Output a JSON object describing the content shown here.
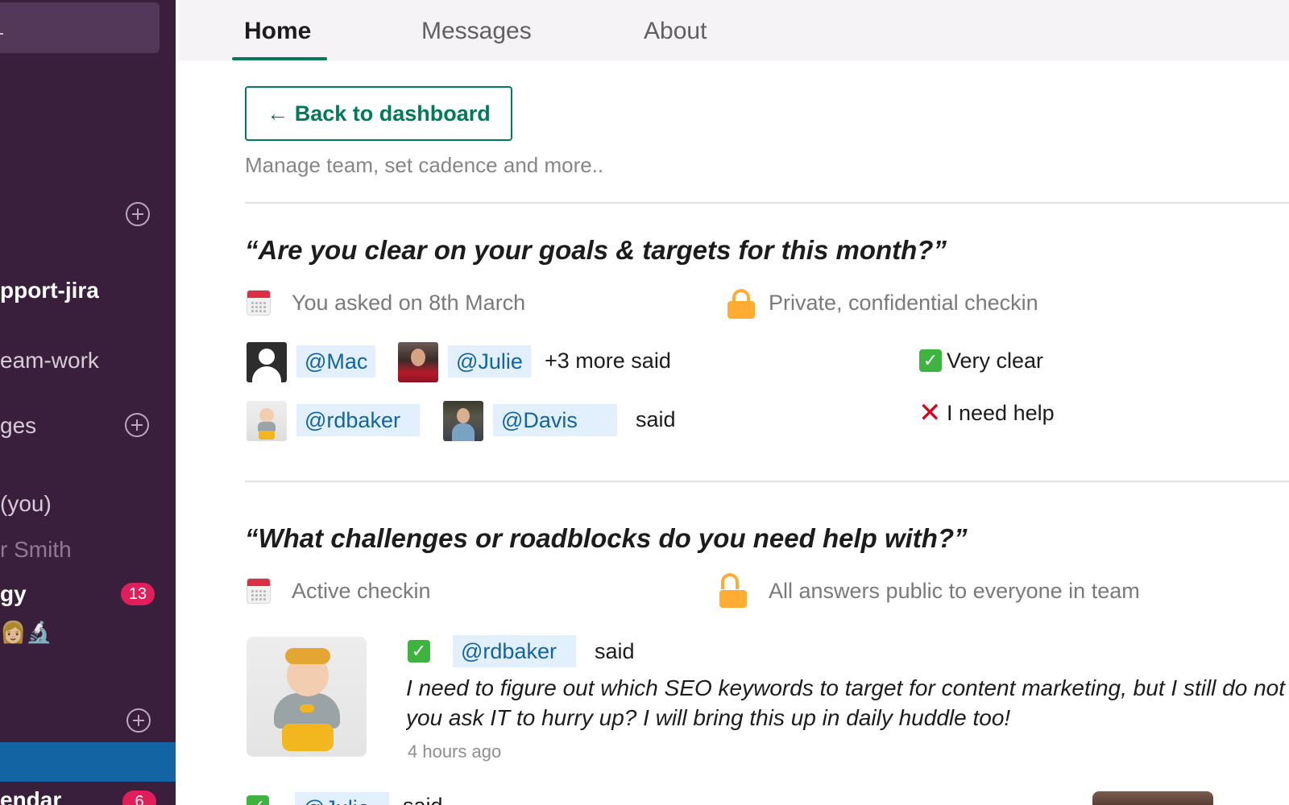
{
  "sidebar": {
    "channel_bold": "pport-jira",
    "channel_teamwork": "eam-work",
    "section_messages": "ges",
    "dm_you": "(you)",
    "dm_smith": "r Smith",
    "dm_gy": "gy",
    "dm_gy_badge": "13",
    "emoji_row": "👩🏼🔬",
    "calendar_item": "endar",
    "calendar_badge": "6"
  },
  "tabs": [
    {
      "label": "Home",
      "active": true
    },
    {
      "label": "Messages",
      "active": false
    },
    {
      "label": "About",
      "active": false
    }
  ],
  "main": {
    "back_button": "← Back to dashboard",
    "subtitle": "Manage team, set cadence and more..",
    "checkins": [
      {
        "question": "“Are you clear on your goals & targets for this month?”",
        "date_text": "You asked on 8th March",
        "privacy_text": "Private, confidential checkin",
        "rows": [
          {
            "mentions": [
              "@Mac",
              "@Julie"
            ],
            "suffix": "+3 more said",
            "answer_icon": "check",
            "answer": "Very clear"
          },
          {
            "mentions": [
              "@rdbaker",
              "@Davis"
            ],
            "suffix": "said",
            "answer_icon": "cross",
            "answer": "I need help"
          }
        ]
      },
      {
        "question": "“What challenges or roadblocks do you need help with?”",
        "date_text": "Active checkin",
        "privacy_text": "All answers public to everyone in team",
        "response": {
          "mention": "@rdbaker",
          "suffix": "said",
          "text_line1": "I need to figure out which SEO keywords to target for content marketing, but I still do not ha",
          "text_line2": "you ask IT to hurry up? I will bring this up in daily huddle too!",
          "time": "4 hours ago"
        },
        "next_response": {
          "mention": "@Julie",
          "suffix": "said"
        }
      }
    ]
  },
  "colors": {
    "sidebar_bg": "#3a1f3d",
    "accent_green": "#007a5a",
    "mention_bg": "#e1f0fc",
    "mention_text": "#1264a3",
    "badge": "#e01e5a",
    "active_item": "#1264a3"
  },
  "icons": [
    "calendar-icon",
    "lock-icon",
    "unlock-icon",
    "check-icon",
    "cross-icon",
    "add-circle-icon"
  ]
}
